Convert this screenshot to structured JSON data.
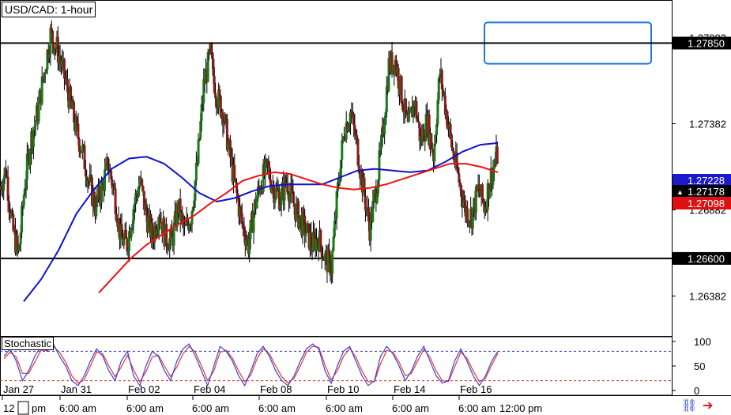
{
  "window": {
    "title": "USD/CAD: 1-hour",
    "indicator_title": "Stochastic"
  },
  "colors": {
    "bull": "#1a7a1a",
    "bear": "#8b1a1a",
    "wick": "#000000",
    "ma_fast": "#1111cc",
    "ma_slow": "#ee1111",
    "resistance": "#000000",
    "target_box": "#2277dd",
    "stoch_k": "#3344dd",
    "stoch_d": "#ee3333",
    "stoch_level_high": "#2233cc",
    "stoch_level_low": "#dd2222",
    "price_tag_dark": "#000000",
    "price_tag_red": "#dd1111",
    "price_tag_blue": "#1a1acc"
  },
  "icons": {
    "link": "link-icon",
    "arrow": "red-arrow-icon"
  },
  "chart_data": {
    "type": "candlestick",
    "title": "USD/CAD: 1-hour",
    "ylim": [
      1.2615,
      1.281
    ],
    "y_ticks": [
      1.26382,
      1.26882,
      1.27382,
      1.27882
    ],
    "x_ticks_top": [
      "Jan 27",
      "Jan 31",
      "Feb 02",
      "Feb 04",
      "Feb 08",
      "Feb 10",
      "Feb 14",
      "Feb 16"
    ],
    "x_ticks_bottom": [
      "12:00 pm",
      "6:00 am",
      "6:00 am",
      "6:00 am",
      "6:00 am",
      "6:00 am",
      "6:00 am",
      "6:00 am",
      "12:00 pm"
    ],
    "price_tags": [
      {
        "label": "1.27850",
        "style": "dark"
      },
      {
        "label": "1.27228",
        "style": "blue"
      },
      {
        "label": "1.27178",
        "style": "dark",
        "marker": "▲"
      },
      {
        "label": "1.27098",
        "style": "red"
      },
      {
        "label": "1.26600",
        "style": "dark"
      }
    ],
    "horizontal_lines": [
      1.2785,
      1.266
    ],
    "target_box": {
      "y_top": 1.2797,
      "y_bottom": 1.2773,
      "x_start": "Feb 17",
      "x_end": "Feb 19"
    },
    "close_path": [
      1.27,
      1.2712,
      1.2678,
      1.2662,
      1.2705,
      1.273,
      1.2745,
      1.2768,
      1.279,
      1.2782,
      1.2768,
      1.2752,
      1.2735,
      1.2722,
      1.2705,
      1.269,
      1.27,
      1.2715,
      1.2698,
      1.2672,
      1.2668,
      1.269,
      1.2705,
      1.2685,
      1.2672,
      1.2688,
      1.2672,
      1.267,
      1.269,
      1.2675,
      1.2685,
      1.2715,
      1.276,
      1.2778,
      1.2755,
      1.2745,
      1.2722,
      1.27,
      1.268,
      1.2668,
      1.269,
      1.2705,
      1.2712,
      1.27,
      1.2695,
      1.2705,
      1.2692,
      1.2683,
      1.2676,
      1.2668,
      1.2672,
      1.266,
      1.2655,
      1.27,
      1.2735,
      1.2745,
      1.2725,
      1.27,
      1.2678,
      1.27,
      1.273,
      1.2772,
      1.2775,
      1.2755,
      1.2735,
      1.2752,
      1.2728,
      1.274,
      1.272,
      1.2768,
      1.2745,
      1.2722,
      1.2705,
      1.2688,
      1.2685,
      1.27,
      1.269,
      1.2708,
      1.272
    ],
    "ma_fast": [
      1.2635,
      1.2648,
      1.2665,
      1.2686,
      1.27,
      1.2712,
      1.2718,
      1.2719,
      1.2715,
      1.2707,
      1.2698,
      1.2693,
      1.2695,
      1.2699,
      1.2702,
      1.2703,
      1.2703,
      1.2703,
      1.2707,
      1.2711,
      1.2712,
      1.2711,
      1.271,
      1.2711,
      1.2716,
      1.2722,
      1.2726,
      1.2727
    ],
    "ma_slow": [
      1.264,
      1.265,
      1.266,
      1.2668,
      1.2674,
      1.268,
      1.2685,
      1.2692,
      1.2698,
      1.2705,
      1.2708,
      1.271,
      1.2709,
      1.2706,
      1.2703,
      1.2701,
      1.27,
      1.2701,
      1.2703,
      1.2706,
      1.2709,
      1.2712,
      1.2715,
      1.2715,
      1.2713,
      1.271
    ],
    "stochastic": {
      "levels": [
        80,
        20
      ],
      "y_ticks": [
        100,
        50,
        0
      ],
      "k": [
        70,
        85,
        60,
        20,
        40,
        70,
        90,
        80,
        95,
        70,
        50,
        20,
        10,
        30,
        60,
        85,
        70,
        40,
        20,
        60,
        80,
        30,
        10,
        50,
        80,
        70,
        40,
        20,
        60,
        85,
        95,
        70,
        40,
        10,
        50,
        90,
        80,
        60,
        30,
        10,
        40,
        75,
        90,
        70,
        40,
        20,
        10,
        30,
        60,
        85,
        95,
        85,
        40,
        15,
        50,
        80,
        90,
        60,
        30,
        10,
        20,
        70,
        90,
        75,
        50,
        20,
        40,
        70,
        90,
        60,
        30,
        15,
        20,
        60,
        85,
        60,
        30,
        10,
        30,
        60,
        80
      ],
      "d": [
        65,
        78,
        68,
        35,
        35,
        58,
        82,
        82,
        90,
        78,
        58,
        30,
        15,
        22,
        50,
        78,
        75,
        50,
        28,
        48,
        72,
        42,
        18,
        38,
        68,
        72,
        50,
        28,
        48,
        75,
        90,
        78,
        50,
        20,
        40,
        78,
        82,
        66,
        40,
        18,
        32,
        65,
        85,
        75,
        50,
        28,
        15,
        25,
        50,
        78,
        90,
        88,
        52,
        22,
        40,
        70,
        86,
        68,
        40,
        18,
        18,
        55,
        82,
        78,
        58,
        30,
        35,
        60,
        84,
        68,
        40,
        20,
        18,
        48,
        78,
        66,
        40,
        18,
        25,
        52,
        76
      ]
    }
  }
}
